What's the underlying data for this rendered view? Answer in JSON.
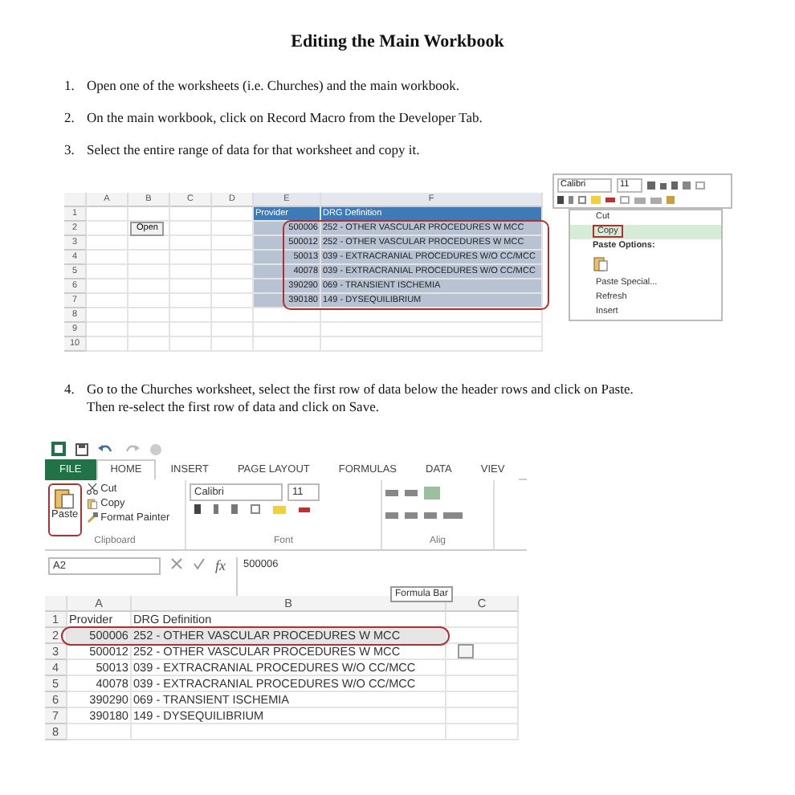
{
  "title": "Editing the Main Workbook",
  "steps_top": [
    {
      "number": "1.",
      "text": "Open one of the worksheets (i.e. Churches) and the main workbook."
    },
    {
      "number": "2.",
      "text": "On the main workbook, click on Record Macro from the Developer Tab."
    },
    {
      "number": "3.",
      "text": "Select the entire range of data for that worksheet and copy it."
    }
  ],
  "screenshot_1": {
    "column_headers": [
      "A",
      "B",
      "C",
      "D",
      "E",
      "F"
    ],
    "row_numbers": [
      "1",
      "2",
      "3",
      "4",
      "5",
      "6",
      "7",
      "8",
      "9",
      "10"
    ],
    "open_button": "Open",
    "table_headers": [
      "Provider",
      "DRG Definition"
    ],
    "rows": [
      {
        "provider": "500006",
        "definition": "252 - OTHER VASCULAR PROCEDURES W MCC"
      },
      {
        "provider": "500012",
        "definition": "252 - OTHER VASCULAR PROCEDURES W MCC"
      },
      {
        "provider": "50013",
        "definition": "039 - EXTRACRANIAL PROCEDURES W/O CC/MCC"
      },
      {
        "provider": "40078",
        "definition": "039 - EXTRACRANIAL PROCEDURES W/O CC/MCC"
      },
      {
        "provider": "390290",
        "definition": "069 - TRANSIENT ISCHEMIA"
      },
      {
        "provider": "390180",
        "definition": "149 - DYSEQUILIBRIUM"
      }
    ],
    "mini_toolbar": {
      "font": "Calibri",
      "size": "11"
    },
    "context_menu": [
      {
        "kind": "item",
        "label": "Cut",
        "selected": false
      },
      {
        "kind": "item",
        "label": "Copy",
        "selected": true
      },
      {
        "kind": "header",
        "label": "Paste Options:",
        "selected": false
      },
      {
        "kind": "icons",
        "selected": false
      },
      {
        "kind": "item",
        "label": "Paste Special...",
        "selected": false
      },
      {
        "kind": "item",
        "label": "Refresh",
        "selected": false
      },
      {
        "kind": "item",
        "label": "Insert",
        "selected": false
      }
    ]
  },
  "step_4": {
    "number": "4.",
    "lines": [
      "Go to the Churches worksheet, select the first row of data below the header rows and click on Paste.",
      "Then re-select the first row of data and click on Save."
    ]
  },
  "screenshot_2": {
    "ribbon_tabs": [
      {
        "kind": "file",
        "label": "FILE",
        "selected": false
      },
      {
        "kind": "tab",
        "label": "HOME",
        "selected": true
      },
      {
        "kind": "tab",
        "label": "INSERT",
        "selected": false
      },
      {
        "kind": "tab",
        "label": "PAGE LAYOUT",
        "selected": false
      },
      {
        "kind": "tab",
        "label": "FORMULAS",
        "selected": false
      },
      {
        "kind": "tab",
        "label": "DATA",
        "selected": false
      },
      {
        "kind": "tab",
        "label": "VIEV",
        "selected": false
      }
    ],
    "clipboard": {
      "paste": "Paste",
      "cut": "Cut",
      "copy": "Copy",
      "format_painter": "Format Painter",
      "group": "Clipboard"
    },
    "font": {
      "name": "Calibri",
      "size": "11",
      "group": "Font"
    },
    "alignment": {
      "group": "Alig"
    },
    "name_box": "A2",
    "function_label": "fx",
    "formula": "500006",
    "tooltip": "Formula Bar",
    "column_headers": [
      "A",
      "B",
      "C"
    ],
    "rows": [
      {
        "number": "1",
        "a": "Provider",
        "b": "DRG Definition",
        "selected": false
      },
      {
        "number": "2",
        "a": "500006",
        "b": "252 - OTHER VASCULAR PROCEDURES W MCC",
        "selected": true
      },
      {
        "number": "3",
        "a": "500012",
        "b": "252 - OTHER VASCULAR PROCEDURES W MCC",
        "selected": false
      },
      {
        "number": "4",
        "a": "50013",
        "b": "039 - EXTRACRANIAL PROCEDURES W/O CC/MCC",
        "selected": false
      },
      {
        "number": "5",
        "a": "40078",
        "b": "039 - EXTRACRANIAL PROCEDURES W/O CC/MCC",
        "selected": false
      },
      {
        "number": "6",
        "a": "390290",
        "b": "069 - TRANSIENT ISCHEMIA",
        "selected": false
      },
      {
        "number": "7",
        "a": "390180",
        "b": "149 - DYSEQUILIBRIUM",
        "selected": false
      },
      {
        "number": "8",
        "selected": false
      }
    ]
  }
}
